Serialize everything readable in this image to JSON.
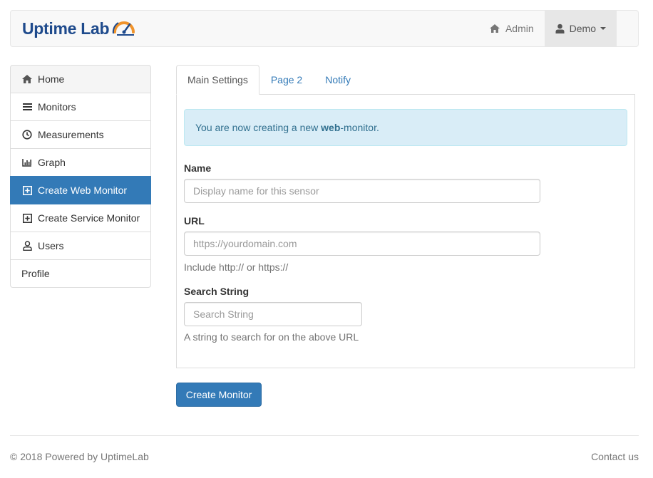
{
  "brand": {
    "name_part1": "Uptime",
    "name_part2": "Lab",
    "color": "#1e4a8c",
    "accent": "#f0932b"
  },
  "navbar": {
    "admin_label": "Admin",
    "user_label": "Demo",
    "admin_icon": "home-icon",
    "user_icon": "user-icon"
  },
  "sidebar": {
    "items": [
      {
        "label": "Home",
        "icon": "home-icon"
      },
      {
        "label": "Monitors",
        "icon": "list-icon"
      },
      {
        "label": "Measurements",
        "icon": "clock-icon"
      },
      {
        "label": "Graph",
        "icon": "bar-chart-icon"
      },
      {
        "label": "Create Web Monitor",
        "icon": "plus-square-icon",
        "active": true
      },
      {
        "label": "Create Service Monitor",
        "icon": "plus-square-icon"
      },
      {
        "label": "Users",
        "icon": "user-outline-icon"
      },
      {
        "label": "Profile"
      }
    ]
  },
  "tabs": [
    {
      "label": "Main Settings",
      "active": true
    },
    {
      "label": "Page 2"
    },
    {
      "label": "Notify"
    }
  ],
  "alert": {
    "prefix": "You are now creating a new ",
    "bold": "web",
    "suffix": "-monitor."
  },
  "form": {
    "name": {
      "label": "Name",
      "placeholder": "Display name for this sensor"
    },
    "url": {
      "label": "URL",
      "placeholder": "https://yourdomain.com",
      "help": "Include http:// or https://"
    },
    "search": {
      "label": "Search String",
      "placeholder": "Search String",
      "help": "A string to search for on the above URL"
    }
  },
  "submit_label": "Create Monitor",
  "footer": {
    "copyright": "© 2018 Powered by UptimeLab",
    "contact": "Contact us"
  },
  "colors": {
    "primary": "#337ab7",
    "alert_bg": "#d9edf7",
    "alert_text": "#31708f"
  }
}
